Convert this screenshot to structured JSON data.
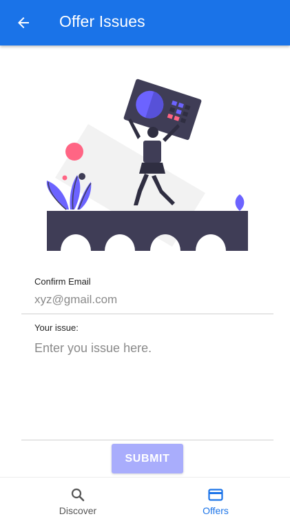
{
  "appbar": {
    "title": "Offer Issues",
    "back_icon": "arrow-left-icon",
    "background": "#1a73e8"
  },
  "illustration": {
    "name": "person-lifting-screen-illustration",
    "colors": {
      "accent": "#6c63ff",
      "dark": "#3f3d56",
      "pink": "#ff6584",
      "light": "#f2f2f2"
    }
  },
  "form": {
    "email": {
      "label": "Confirm Email",
      "value": "",
      "placeholder": "xyz@gmail.com"
    },
    "issue": {
      "label": "Your issue:",
      "value": "",
      "placeholder": "Enter you issue here."
    },
    "submit_label": "SUBMIT",
    "submit_color": "#a9adfc"
  },
  "bottom_nav": {
    "items": [
      {
        "label": "Discover",
        "icon": "search-icon",
        "active": false
      },
      {
        "label": "Offers",
        "icon": "credit-card-icon",
        "active": true
      }
    ],
    "active_color": "#1a73e8"
  }
}
